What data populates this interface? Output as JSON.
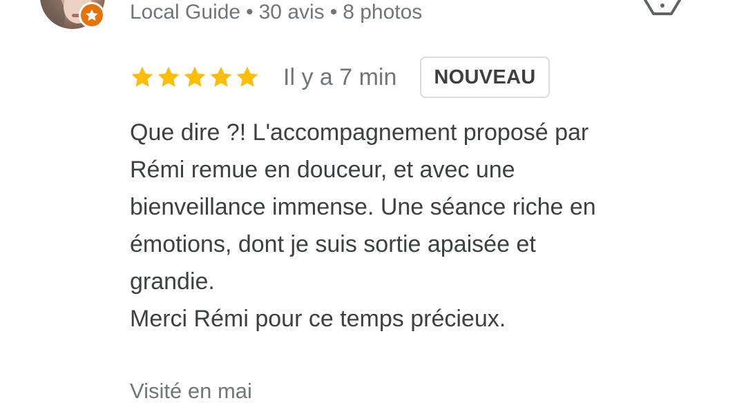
{
  "reviewer": {
    "meta": {
      "level": "Local Guide",
      "separator": "•",
      "reviews": "30 avis",
      "photos": "8 photos"
    },
    "avatar_icon": "user-photo",
    "badge_icon": "local-guide-star-icon"
  },
  "actions": {
    "flag_icon": "flag-report-icon"
  },
  "review": {
    "rating": 5,
    "rating_max": 5,
    "time": "Il y a 7 min",
    "badge": "NOUVEAU",
    "lines": [
      "Que dire ?! L'accompagnement proposé par",
      "Rémi remue en douceur, et avec une",
      "bienveillance immense. Une séance riche en",
      "émotions, dont je suis sortie apaisée et",
      "grandie.",
      "Merci Rémi pour ce temps précieux."
    ],
    "visited": "Visité en mai"
  },
  "colors": {
    "star": "#fbbc04",
    "badge_orange": "#e8710a",
    "text_primary": "#3c4043",
    "text_secondary": "#70757a",
    "border": "#dadce0"
  }
}
